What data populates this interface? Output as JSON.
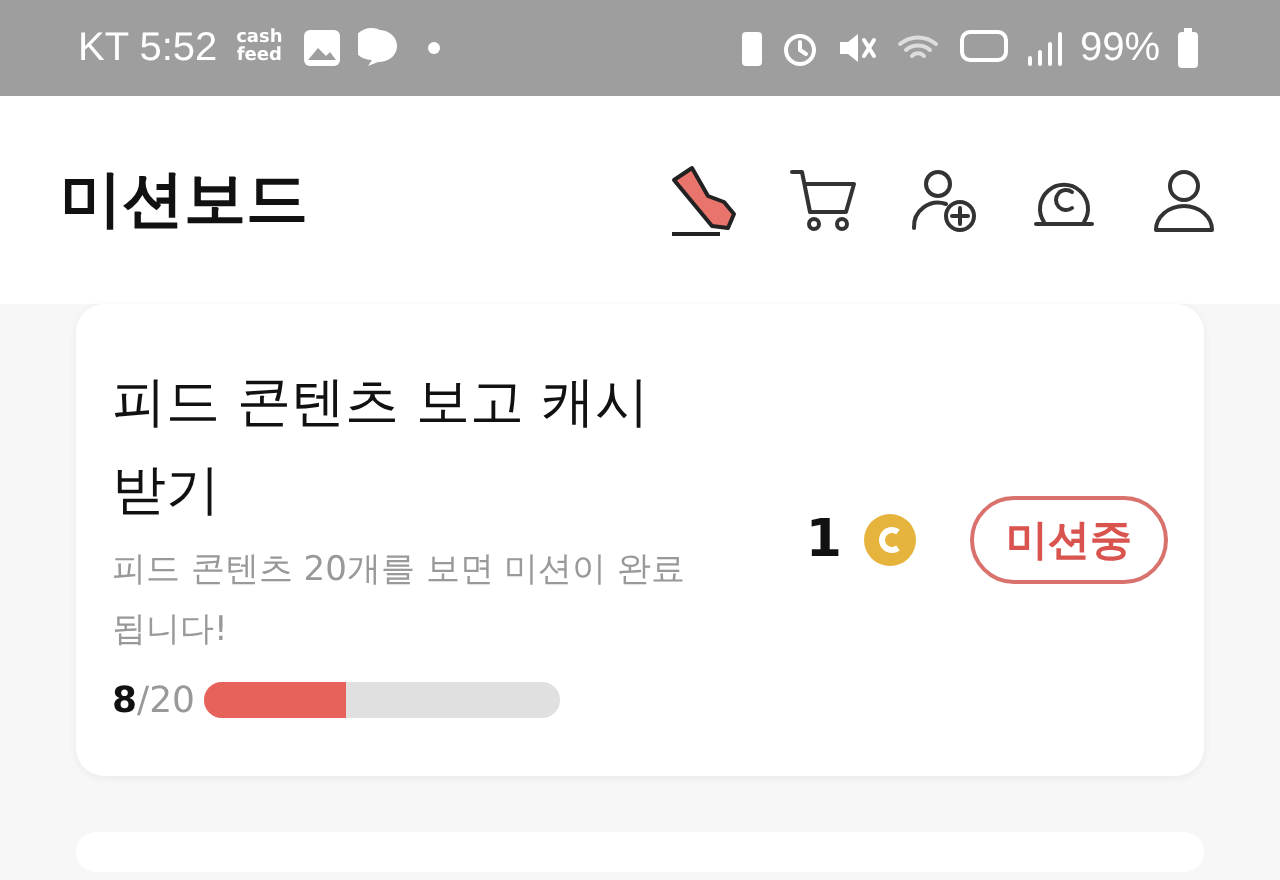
{
  "status_bar": {
    "carrier_time": "KT 5:52",
    "app_badge": "cash feed",
    "battery": "99%"
  },
  "header": {
    "title": "미션보드"
  },
  "missions": [
    {
      "title": "피드 콘텐츠 보고 캐시 받기",
      "description": "피드 콘텐츠 20개를 보면 미션이 완료됩니다!",
      "progress": "**8**/20",
      "level": 0.4,
      "reward": "1",
      "status": "미션중"
    }
  ]
}
